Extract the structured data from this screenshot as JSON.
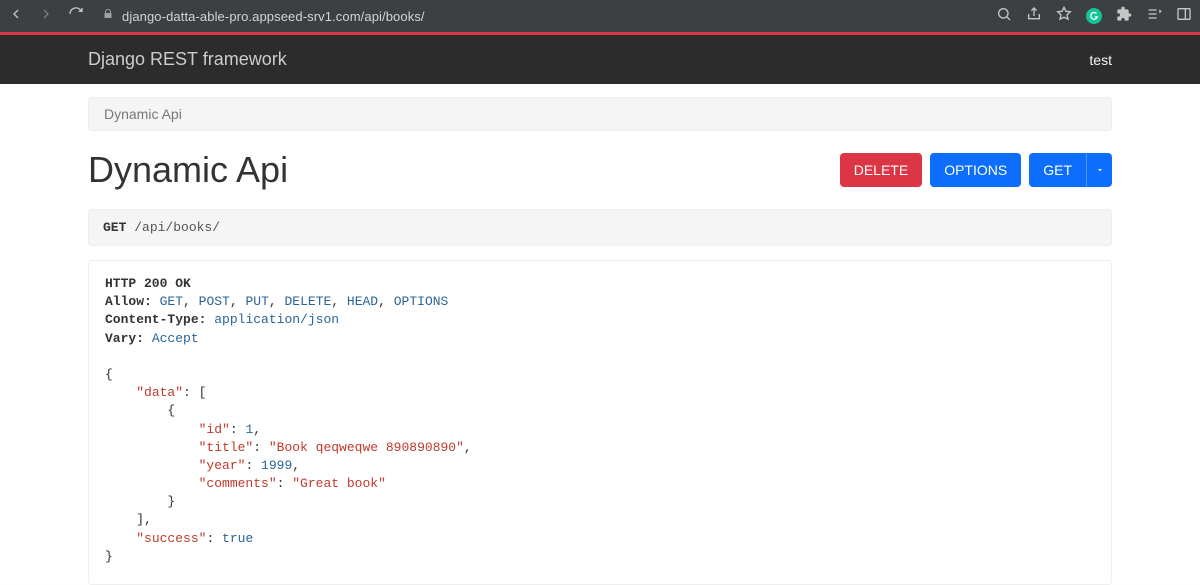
{
  "browser": {
    "url": "django-datta-able-pro.appseed-srv1.com/api/books/"
  },
  "navbar": {
    "brand": "Django REST framework",
    "user": "test"
  },
  "breadcrumb": {
    "label": "Dynamic Api"
  },
  "header": {
    "title": "Dynamic Api",
    "buttons": {
      "delete": "DELETE",
      "options": "OPTIONS",
      "get": "GET"
    }
  },
  "request": {
    "method": "GET",
    "path": "/api/books/"
  },
  "response": {
    "status_line": "HTTP 200 OK",
    "headers": {
      "allow_label": "Allow:",
      "allow_methods": [
        "GET",
        "POST",
        "PUT",
        "DELETE",
        "HEAD",
        "OPTIONS"
      ],
      "content_type_label": "Content-Type:",
      "content_type_value": "application/json",
      "vary_label": "Vary:",
      "vary_value": "Accept"
    },
    "body": {
      "data": [
        {
          "id": 1,
          "title": "Book qeqweqwe 890890890",
          "year": 1999,
          "comments": "Great book"
        }
      ],
      "success": true
    }
  }
}
